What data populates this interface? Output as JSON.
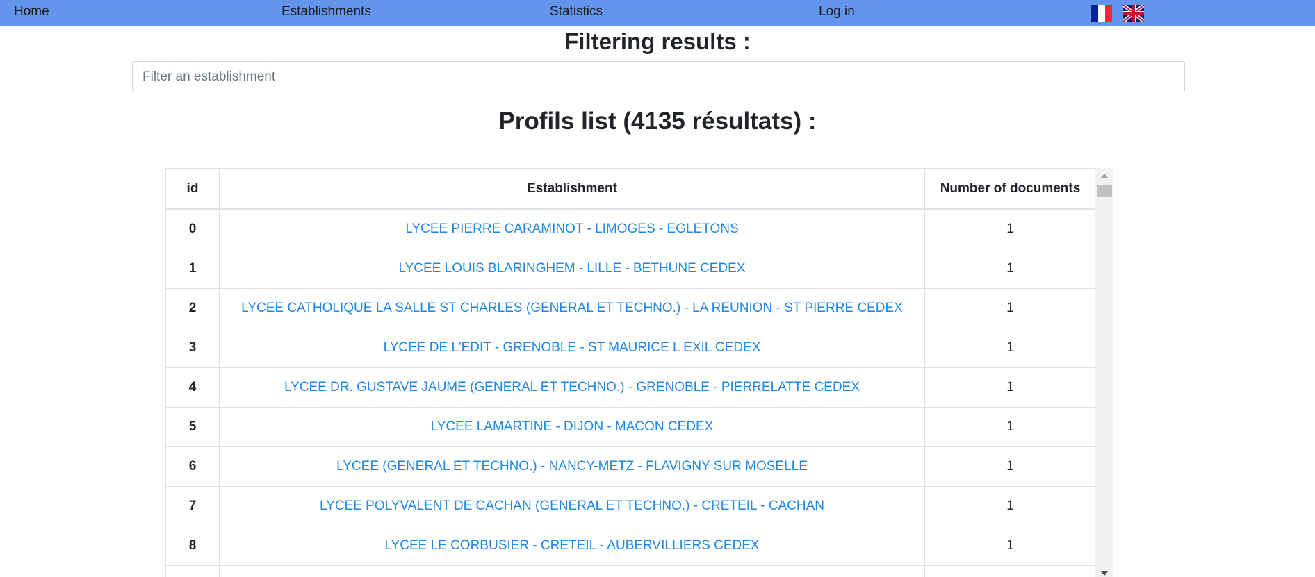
{
  "nav": {
    "home": "Home",
    "establishments": "Establishments",
    "statistics": "Statistics",
    "login": "Log in",
    "languages": [
      "french-flag-icon",
      "uk-flag-icon"
    ]
  },
  "filter": {
    "title": "Filtering results :",
    "placeholder": "Filter an establishment"
  },
  "list": {
    "title": "Profils list (4135 résultats) :",
    "columns": {
      "id": "id",
      "establishment": "Establishment",
      "documents": "Number of documents"
    },
    "rows": [
      {
        "id": "0",
        "establishment": "LYCEE PIERRE CARAMINOT - LIMOGES - EGLETONS",
        "documents": "1"
      },
      {
        "id": "1",
        "establishment": "LYCEE LOUIS BLARINGHEM - LILLE - BETHUNE CEDEX",
        "documents": "1"
      },
      {
        "id": "2",
        "establishment": "LYCEE CATHOLIQUE LA SALLE ST CHARLES (GENERAL ET TECHNO.) - LA REUNION - ST PIERRE CEDEX",
        "documents": "1"
      },
      {
        "id": "3",
        "establishment": "LYCEE DE L'EDIT - GRENOBLE - ST MAURICE L EXIL CEDEX",
        "documents": "1"
      },
      {
        "id": "4",
        "establishment": "LYCEE DR. GUSTAVE JAUME (GENERAL ET TECHNO.) - GRENOBLE - PIERRELATTE CEDEX",
        "documents": "1"
      },
      {
        "id": "5",
        "establishment": "LYCEE LAMARTINE - DIJON - MACON CEDEX",
        "documents": "1"
      },
      {
        "id": "6",
        "establishment": "LYCEE (GENERAL ET TECHNO.) - NANCY-METZ - FLAVIGNY SUR MOSELLE",
        "documents": "1"
      },
      {
        "id": "7",
        "establishment": "LYCEE POLYVALENT DE CACHAN (GENERAL ET TECHNO.) - CRETEIL - CACHAN",
        "documents": "1"
      },
      {
        "id": "8",
        "establishment": "LYCEE LE CORBUSIER - CRETEIL - AUBERVILLIERS CEDEX",
        "documents": "1"
      },
      {
        "id": "",
        "establishment": "",
        "documents": ""
      }
    ]
  }
}
